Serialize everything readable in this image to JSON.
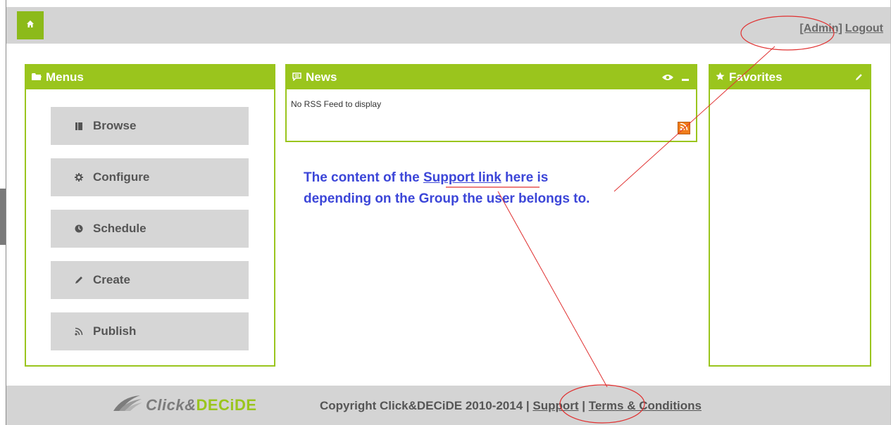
{
  "colors": {
    "accent": "#9ac51d",
    "annotation": "#3c46d8",
    "callout": "#e03030",
    "rss": "#f07d1b"
  },
  "topbar": {
    "home_icon": "home-icon",
    "admin_label": "[Admin]",
    "logout_label": "Logout"
  },
  "menus": {
    "title": "Menus",
    "icon": "folder-icon",
    "items": [
      {
        "label": "Browse",
        "icon": "list-icon"
      },
      {
        "label": "Configure",
        "icon": "gear-icon"
      },
      {
        "label": "Schedule",
        "icon": "clock-icon"
      },
      {
        "label": "Create",
        "icon": "pencil-icon"
      },
      {
        "label": "Publish",
        "icon": "rss-icon"
      }
    ]
  },
  "news": {
    "title": "News",
    "icon": "chat-icon",
    "empty_text": "No RSS Feed to display"
  },
  "favorites": {
    "title": "Favorites",
    "icon": "star-icon"
  },
  "annotation": {
    "line1_before": "The content of the ",
    "line1_link": "Support link",
    "line1_after": " here is",
    "line2": "depending on the Group the user belongs to."
  },
  "footer": {
    "logo_click": "Click&",
    "logo_decide": "DECiDE",
    "copyright": "Copyright Click&DECiDE 2010-2014 | ",
    "support_label": "Support",
    "separator": " | ",
    "terms_label": "Terms & Conditions"
  }
}
